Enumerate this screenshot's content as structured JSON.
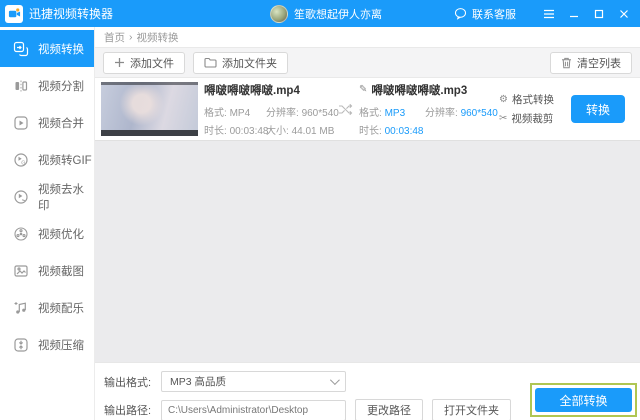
{
  "titlebar": {
    "app_title": "迅捷视频转换器",
    "username": "笙歌想起伊人亦离",
    "contact_label": "联系客服"
  },
  "sidebar": {
    "items": [
      {
        "label": "视频转换",
        "active": true
      },
      {
        "label": "视频分割",
        "active": false
      },
      {
        "label": "视频合并",
        "active": false
      },
      {
        "label": "视频转GIF",
        "active": false
      },
      {
        "label": "视频去水印",
        "active": false
      },
      {
        "label": "视频优化",
        "active": false
      },
      {
        "label": "视频截图",
        "active": false
      },
      {
        "label": "视频配乐",
        "active": false
      },
      {
        "label": "视频压缩",
        "active": false
      }
    ]
  },
  "breadcrumb": {
    "home": "首页",
    "separator": "›",
    "current": "视频转换"
  },
  "toolbar": {
    "add_file": "添加文件",
    "add_folder": "添加文件夹",
    "clear_list": "清空列表"
  },
  "file_row": {
    "source": {
      "name": "嘚啵嘚啵嘚啵.mp4",
      "format_label": "格式:",
      "format": "MP4",
      "resolution_label": "分辨率:",
      "resolution": "960*540",
      "duration_label": "时长:",
      "duration": "00:03:48",
      "size_label": "大小:",
      "size": "44.01 MB"
    },
    "target": {
      "name": "嘚啵嘚啵嘚啵.mp3",
      "format_label": "格式:",
      "format": "MP3",
      "resolution_label": "分辨率:",
      "resolution": "960*540",
      "duration_label": "时长:",
      "duration": "00:03:48"
    },
    "actions": {
      "format_convert": "格式转换",
      "video_crop": "视频裁剪",
      "convert": "转换"
    }
  },
  "footer": {
    "output_format_label": "输出格式:",
    "output_format_value": "MP3 高品质",
    "output_path_label": "输出路径:",
    "output_path_value": "C:\\Users\\Administrator\\Desktop",
    "change_path": "更改路径",
    "open_folder": "打开文件夹",
    "convert_all": "全部转换"
  },
  "icons": {
    "pencil": "✎",
    "gear": "⚙",
    "scissors": "✂"
  },
  "colors": {
    "accent": "#1a9bfa",
    "highlight_border": "#afc653",
    "titlebar": "#1a9bfa"
  }
}
